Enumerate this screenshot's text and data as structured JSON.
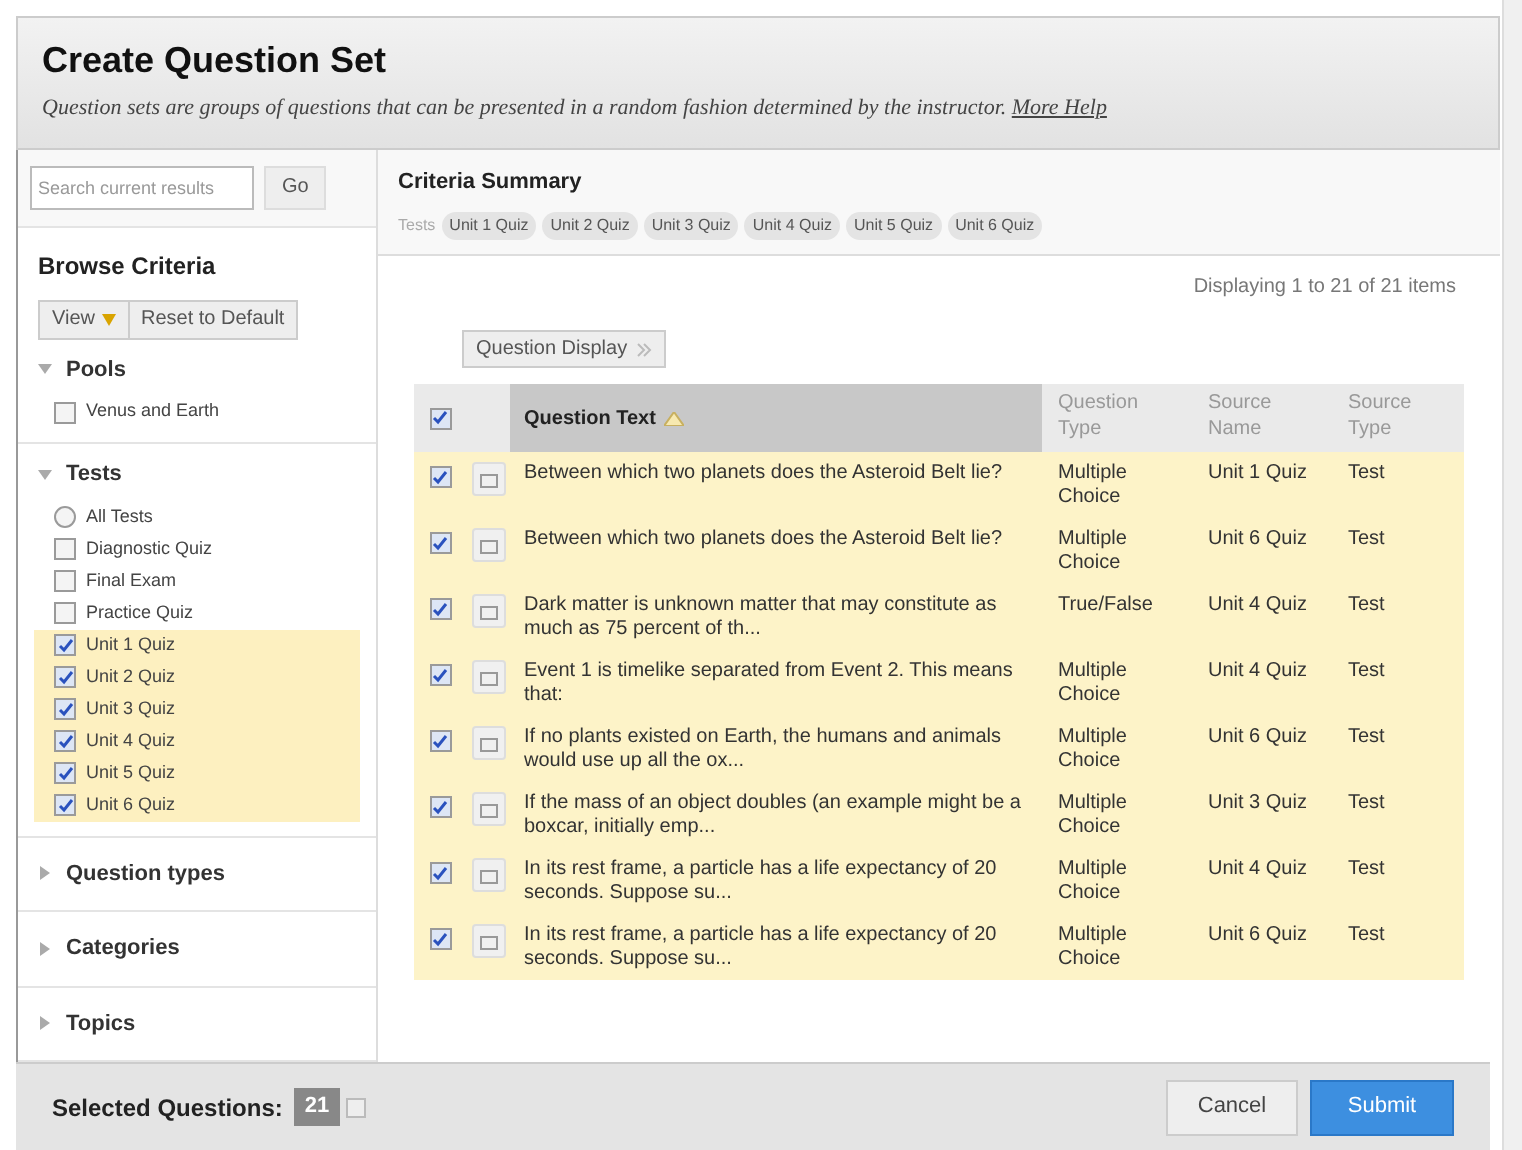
{
  "header": {
    "title": "Create Question Set",
    "description": "Question sets are groups of questions that can be presented in a random fashion determined by the instructor.",
    "help_link": "More Help"
  },
  "sidebar": {
    "search": {
      "placeholder": "Search current results",
      "button": "Go"
    },
    "title": "Browse Criteria",
    "view_button": "View",
    "reset_button": "Reset to Default",
    "sections": [
      {
        "label": "Pools",
        "expanded": true,
        "items": [
          {
            "kind": "checkbox",
            "label": "Venus and Earth",
            "checked": false
          }
        ]
      },
      {
        "label": "Tests",
        "expanded": true,
        "items": [
          {
            "kind": "radio",
            "label": "All Tests",
            "checked": false
          },
          {
            "kind": "checkbox",
            "label": "Diagnostic Quiz",
            "checked": false
          },
          {
            "kind": "checkbox",
            "label": "Final Exam",
            "checked": false
          },
          {
            "kind": "checkbox",
            "label": "Practice Quiz",
            "checked": false
          },
          {
            "kind": "checkbox",
            "label": "Unit 1 Quiz",
            "checked": true
          },
          {
            "kind": "checkbox",
            "label": "Unit 2 Quiz",
            "checked": true
          },
          {
            "kind": "checkbox",
            "label": "Unit 3 Quiz",
            "checked": true
          },
          {
            "kind": "checkbox",
            "label": "Unit 4 Quiz",
            "checked": true
          },
          {
            "kind": "checkbox",
            "label": "Unit 5 Quiz",
            "checked": true
          },
          {
            "kind": "checkbox",
            "label": "Unit 6 Quiz",
            "checked": true
          }
        ]
      },
      {
        "label": "Question types",
        "expanded": false
      },
      {
        "label": "Categories",
        "expanded": false
      },
      {
        "label": "Topics",
        "expanded": false
      }
    ]
  },
  "summary": {
    "title": "Criteria Summary",
    "filter_label": "Tests",
    "tags": [
      "Unit 1 Quiz",
      "Unit 2 Quiz",
      "Unit 3 Quiz",
      "Unit 4 Quiz",
      "Unit 5 Quiz",
      "Unit 6 Quiz"
    ]
  },
  "paging": "Displaying 1 to 21 of 21 items",
  "display_button": "Question Display",
  "table": {
    "all_checked": true,
    "columns": [
      "Question Text",
      "Question Type",
      "Source Name",
      "Source Type"
    ],
    "rows": [
      {
        "checked": true,
        "text": "Between which two planets does the Asteroid Belt lie?",
        "type": "Multiple Choice",
        "source": "Unit 1 Quiz",
        "source_type": "Test"
      },
      {
        "checked": true,
        "text": "Between which two planets does the Asteroid Belt lie?",
        "type": "Multiple Choice",
        "source": "Unit 6 Quiz",
        "source_type": "Test"
      },
      {
        "checked": true,
        "text": "Dark matter is unknown matter that may constitute as much as 75 percent of th...",
        "type": "True/False",
        "source": "Unit 4 Quiz",
        "source_type": "Test"
      },
      {
        "checked": true,
        "text": "Event 1 is timelike separated from Event 2. This means that:",
        "type": "Multiple Choice",
        "source": "Unit 4 Quiz",
        "source_type": "Test"
      },
      {
        "checked": true,
        "text": "If no plants existed on Earth, the humans and animals would use up all the ox...",
        "type": "Multiple Choice",
        "source": "Unit 6 Quiz",
        "source_type": "Test"
      },
      {
        "checked": true,
        "text": "If the mass of an object doubles (an example might be a boxcar, initially emp...",
        "type": "Multiple Choice",
        "source": "Unit 3 Quiz",
        "source_type": "Test"
      },
      {
        "checked": true,
        "text": "In its rest frame, a particle has a life expectancy of 20 seconds. Suppose su...",
        "type": "Multiple Choice",
        "source": "Unit 4 Quiz",
        "source_type": "Test"
      },
      {
        "checked": true,
        "text": "In its rest frame, a particle has a life expectancy of 20 seconds. Suppose su...",
        "type": "Multiple Choice",
        "source": "Unit 6 Quiz",
        "source_type": "Test"
      }
    ]
  },
  "footer": {
    "label": "Selected Questions:",
    "count": "21",
    "buttons": [
      "Cancel",
      "Submit"
    ]
  }
}
